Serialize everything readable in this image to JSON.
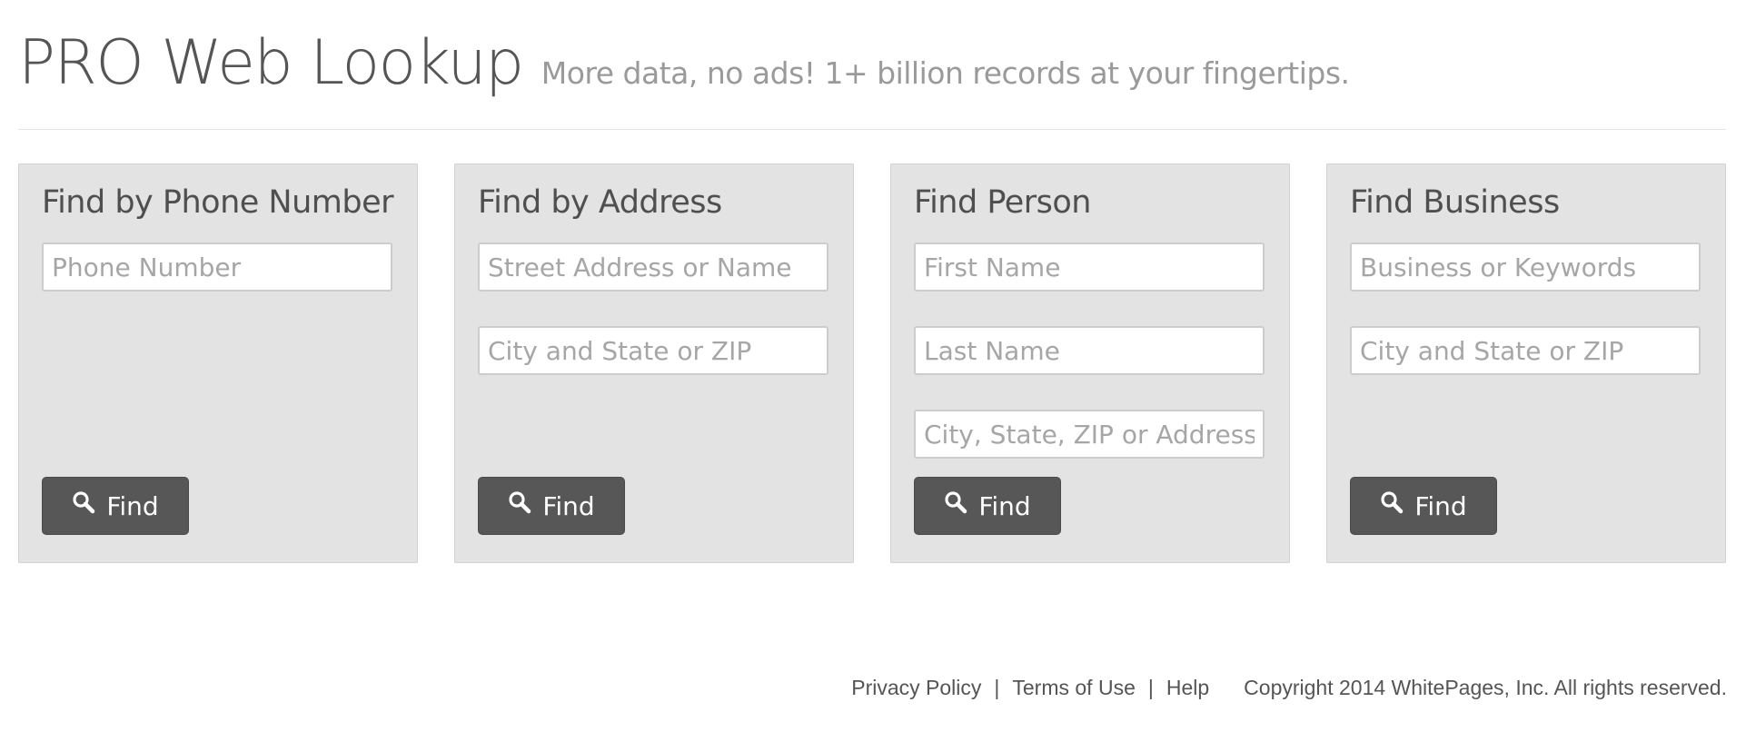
{
  "header": {
    "title": "PRO Web Lookup",
    "tagline": "More data, no ads! 1+ billion records at your fingertips."
  },
  "panels": [
    {
      "title": "Find by Phone Number",
      "fields": [
        {
          "placeholder": "Phone Number",
          "value": ""
        }
      ],
      "button_label": "Find"
    },
    {
      "title": "Find by Address",
      "fields": [
        {
          "placeholder": "Street Address or Name",
          "value": ""
        },
        {
          "placeholder": "City and State or ZIP",
          "value": ""
        }
      ],
      "button_label": "Find"
    },
    {
      "title": "Find Person",
      "fields": [
        {
          "placeholder": "First Name",
          "value": ""
        },
        {
          "placeholder": "Last Name",
          "value": ""
        },
        {
          "placeholder": "City, State, ZIP or Address",
          "value": ""
        }
      ],
      "button_label": "Find"
    },
    {
      "title": "Find Business",
      "fields": [
        {
          "placeholder": "Business or Keywords",
          "value": ""
        },
        {
          "placeholder": "City and State or ZIP",
          "value": ""
        }
      ],
      "button_label": "Find"
    }
  ],
  "footer": {
    "links": [
      "Privacy Policy",
      "Terms of Use",
      "Help"
    ],
    "separator": "|",
    "copyright": "Copyright 2014 WhitePages, Inc. All rights reserved."
  },
  "icons": {
    "find_button": "search-icon"
  },
  "colors": {
    "panel_background": "#e3e3e3",
    "button_background": "#575757",
    "button_text": "#ffffff",
    "title_text": "#555555",
    "tagline_text": "#9a9a9a",
    "placeholder_text": "#a6a6a6"
  }
}
